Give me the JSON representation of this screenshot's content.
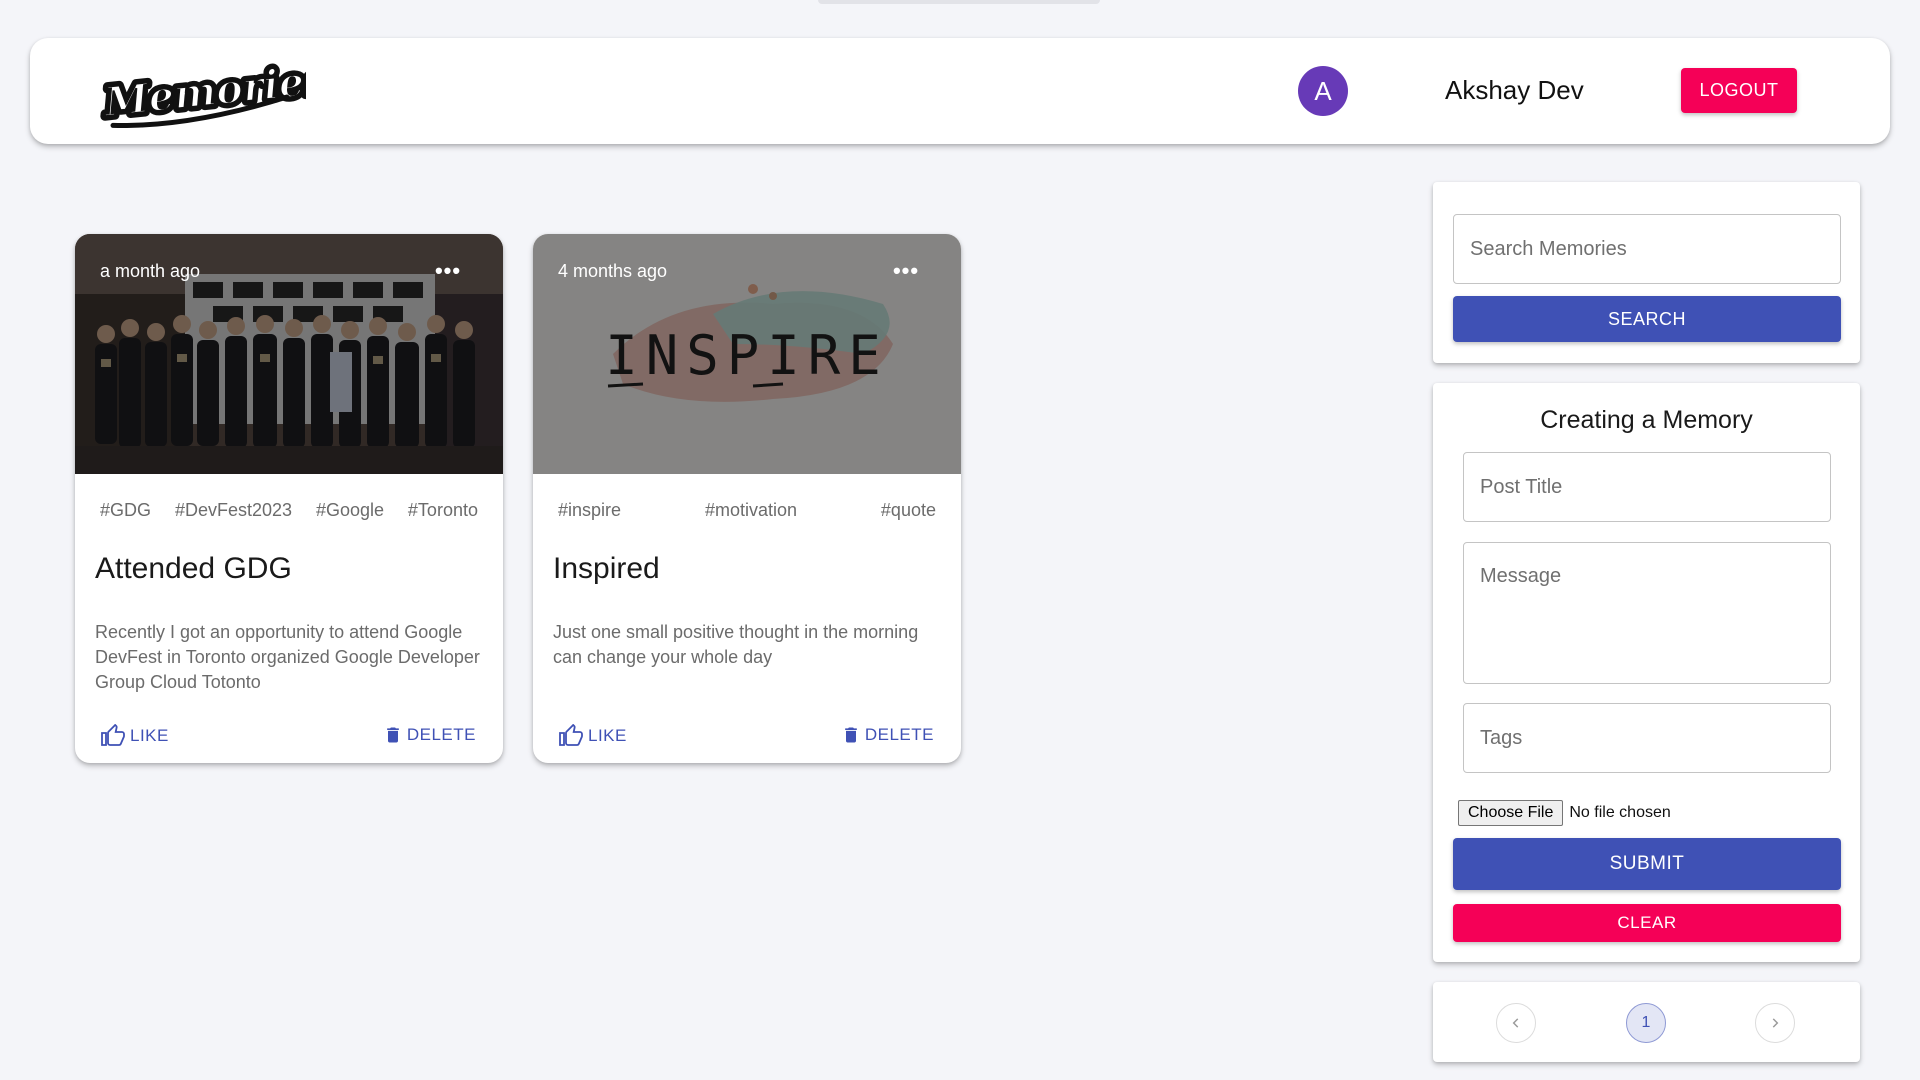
{
  "header": {
    "logo_text": "Memories",
    "avatar_initial": "A",
    "user_name": "Akshay Dev",
    "logout_label": "LOGOUT"
  },
  "posts": [
    {
      "time": "a month ago",
      "tags": [
        "#GDG",
        "#DevFest2023",
        "#Google",
        "#Toronto"
      ],
      "title": "Attended GDG",
      "message": "Recently I got an opportunity to attend Google DevFest in Toronto organized Google Developer Group Cloud Totonto",
      "like_label": "LIKE",
      "delete_label": "DELETE",
      "image": "group-photo"
    },
    {
      "time": "4 months ago",
      "tags": [
        "#inspire",
        "#motivation",
        "#quote"
      ],
      "title": "Inspired",
      "message": "Just one small positive thought in the morning can change your whole day",
      "like_label": "LIKE",
      "delete_label": "DELETE",
      "image": "inspire-brushstroke",
      "image_text": "INSPIRE"
    }
  ],
  "search": {
    "placeholder": "Search Memories",
    "button_label": "SEARCH"
  },
  "form": {
    "title": "Creating a Memory",
    "title_placeholder": "Post Title",
    "message_placeholder": "Message",
    "tags_placeholder": "Tags",
    "choose_file_label": "Choose File",
    "file_status": "No file chosen",
    "submit_label": "SUBMIT",
    "clear_label": "CLEAR"
  },
  "pagination": {
    "current_page": "1",
    "prev_icon": "chevron-left-icon",
    "next_icon": "chevron-right-icon"
  },
  "colors": {
    "primary": "#3f51b5",
    "secondary": "#f50057",
    "avatar": "#673ab7",
    "background": "#f4f5f9"
  }
}
